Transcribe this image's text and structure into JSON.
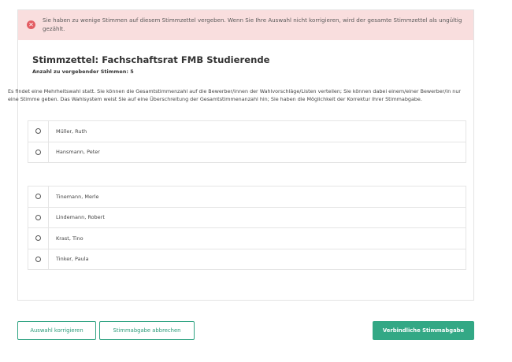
{
  "alert": {
    "icon": "close-circle-icon",
    "message": "Sie haben zu wenige Stimmen auf diesem Stimmzettel vergeben. Wenn Sie Ihre Auswahl nicht korrigieren, wird der gesamte Stimmzettel als ungültig gezählt.",
    "color": "#e35d63"
  },
  "ballot": {
    "title": "Stimmzettel: Fachschaftsrat FMB Studierende",
    "votes_label": "Anzahl zu vergebender Stimmen: 5",
    "description": "Es findet eine Mehrheitswahl statt. Sie können die Gesamtstimmenzahl auf die Bewerber/innen der Wahlvorschläge/Listen verteilen; Sie können dabei einem/einer Bewerber/in nur eine Stimme geben. Das Wahlsystem weist Sie auf eine Überschreitung der Gesamtstimmenanzahl hin; Sie haben die Möglichkeit der Korrektur Ihrer Stimmabgabe.",
    "group1": [
      "Müller, Ruth",
      "Hansmann, Peter"
    ],
    "group2": [
      "Tinemann, Merle",
      "Lindemann, Robert",
      "Krast, Tino",
      "Tinker, Paula"
    ]
  },
  "actions": {
    "correct_label": "Auswahl korrigieren",
    "cancel_label": "Stimmabgabe abbrechen",
    "submit_label": "Verbindliche Stimmabgabe",
    "accent_color": "#33a885"
  }
}
